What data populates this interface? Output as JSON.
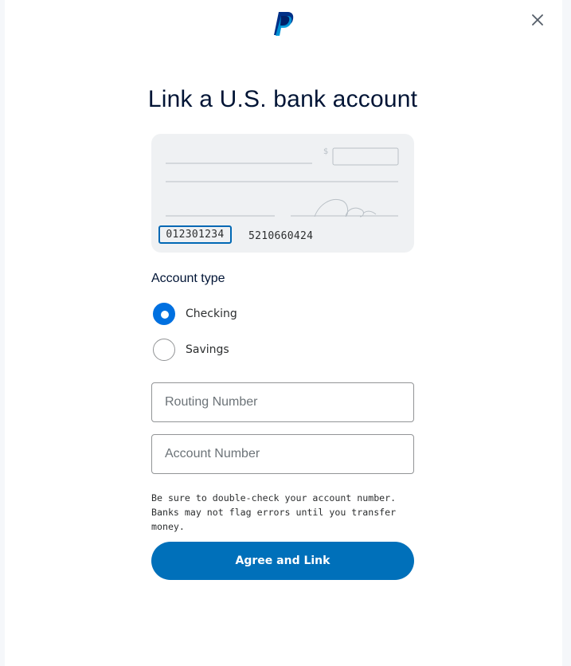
{
  "header": {
    "logo_icon": "paypal-logo-icon",
    "close_icon": "close-icon"
  },
  "title": "Link a U.S. bank account",
  "check_illustration": {
    "currency_symbol": "$",
    "routing_number": "012301234",
    "account_number": "5210660424"
  },
  "account_type": {
    "label": "Account type",
    "options": [
      {
        "label": "Checking",
        "selected": true
      },
      {
        "label": "Savings",
        "selected": false
      }
    ]
  },
  "fields": {
    "routing": {
      "placeholder": "Routing Number",
      "value": ""
    },
    "account": {
      "placeholder": "Account Number",
      "value": ""
    }
  },
  "note": "Be sure to double-check your account number. Banks may not flag errors until you transfer money.",
  "primary_button": {
    "label": "Agree and Link"
  },
  "colors": {
    "primary": "#0070ba",
    "radio_selected": "#0070e0",
    "highlight_border": "#0068b4",
    "text_dark": "#001435"
  }
}
